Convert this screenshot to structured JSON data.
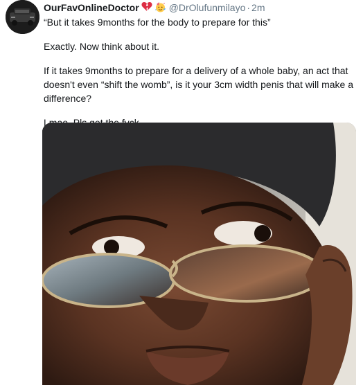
{
  "tweet": {
    "display_name": "OurFavOnlineDoctor",
    "handle": "@DrOlufunmilayo",
    "separator": "·",
    "timestamp": "2m",
    "emojis": [
      "broken-heart-emoji",
      "party-face-emoji"
    ],
    "paragraphs": [
      "“But it takes 9months for the body to prepare for this”",
      "Exactly. Now think about it.",
      "If it takes 9months to prepare for a delivery of a whole baby, an act that doesn't even “shift the womb”, is it your 3cm width penis that will make a difference?",
      "Lmao. Pls get the fvck."
    ]
  },
  "colors": {
    "text": "#14171a",
    "muted": "#657786",
    "avatar_bg": "#1c1c1c"
  }
}
